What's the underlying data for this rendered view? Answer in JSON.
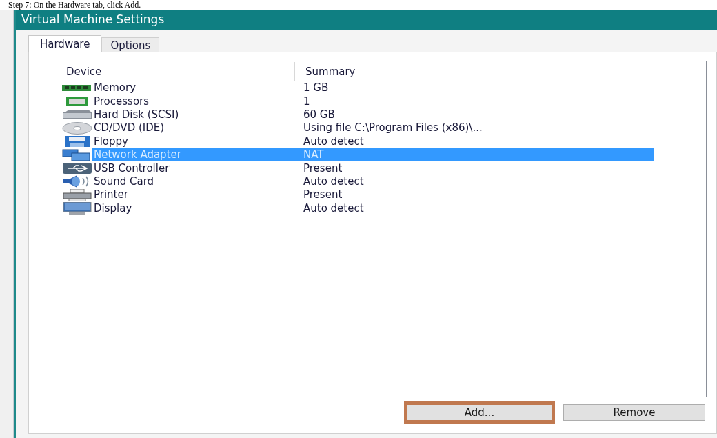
{
  "caption": "Step 7: On the Hardware tab, click Add.",
  "window": {
    "title": "Virtual Machine Settings"
  },
  "tabs": [
    {
      "label": "Hardware",
      "selected": true
    },
    {
      "label": "Options",
      "selected": false
    }
  ],
  "table": {
    "columns": [
      "Device",
      "Summary"
    ],
    "rows": [
      {
        "device": "Memory",
        "summary": "1 GB",
        "selected": false
      },
      {
        "device": "Processors",
        "summary": "1",
        "selected": false
      },
      {
        "device": "Hard Disk (SCSI)",
        "summary": "60 GB",
        "selected": false
      },
      {
        "device": "CD/DVD (IDE)",
        "summary": "Using file C:\\Program Files (x86)\\...",
        "selected": false
      },
      {
        "device": "Floppy",
        "summary": "Auto detect",
        "selected": false
      },
      {
        "device": "Network Adapter",
        "summary": "NAT",
        "selected": true
      },
      {
        "device": "USB Controller",
        "summary": "Present",
        "selected": false
      },
      {
        "device": "Sound Card",
        "summary": "Auto detect",
        "selected": false
      },
      {
        "device": "Printer",
        "summary": "Present",
        "selected": false
      },
      {
        "device": "Display",
        "summary": "Auto detect",
        "selected": false
      }
    ]
  },
  "buttons": [
    {
      "label": "Add...",
      "highlighted": true
    },
    {
      "label": "Remove",
      "highlighted": false
    }
  ]
}
